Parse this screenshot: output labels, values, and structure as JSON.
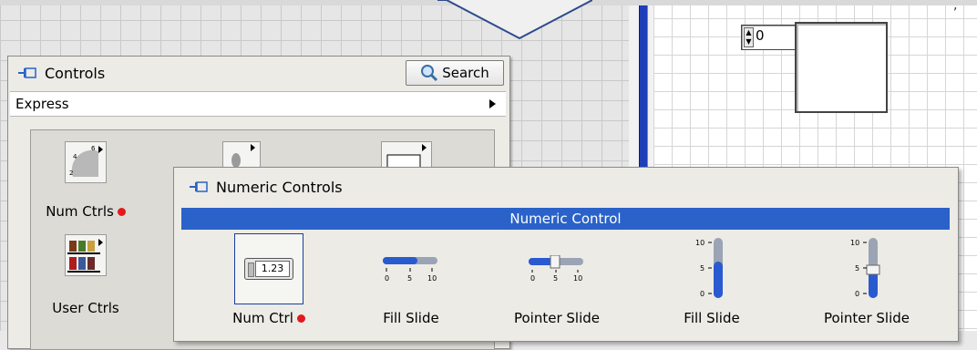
{
  "controls_palette": {
    "title": "Controls",
    "search_label": "Search",
    "category": "Express",
    "items": [
      {
        "label": "Num Ctrls",
        "has_indicator": true
      },
      {
        "label": "User Ctrls",
        "has_indicator": false
      }
    ]
  },
  "numeric_palette": {
    "title": "Numeric Controls",
    "header": "Numeric Control",
    "items": [
      {
        "label": "Num Ctrl",
        "has_indicator": true
      },
      {
        "label": "Fill Slide"
      },
      {
        "label": "Pointer Slide"
      },
      {
        "label": "Fill Slide"
      },
      {
        "label": "Pointer Slide"
      }
    ],
    "num_ctrl_value": "1.23",
    "h_scale_ticks": [
      "0",
      "5",
      "10"
    ],
    "v_scale_ticks": [
      "10",
      "5",
      "0"
    ]
  },
  "front_panel": {
    "numeric_value": "0"
  },
  "colors": {
    "accent_blue": "#2a62c9",
    "indicator_red": "#e21a1a"
  }
}
